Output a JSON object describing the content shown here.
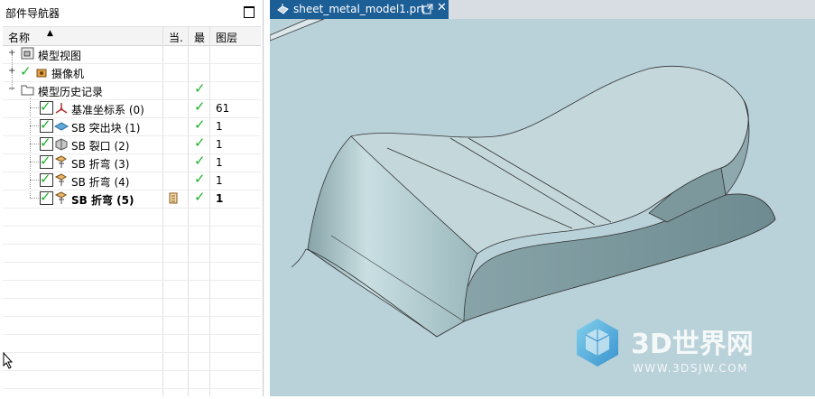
{
  "navigator": {
    "title": "部件导航器",
    "columns": {
      "name": "名称",
      "current": "当.",
      "latest": "最",
      "layer": "图层"
    },
    "rows": [
      {
        "label": "模型视图",
        "layer": "",
        "latest": false,
        "checkbox": false,
        "icon": "model-views-icon"
      },
      {
        "label": "摄像机",
        "layer": "",
        "latest": false,
        "checkbox": false,
        "icon": "camera-icon"
      },
      {
        "label": "模型历史记录",
        "layer": "",
        "latest": true,
        "checkbox": false,
        "icon": "folder-icon"
      },
      {
        "label": "基准坐标系 (0)",
        "layer": "61",
        "latest": true,
        "checkbox": true,
        "icon": "datum-csys-icon"
      },
      {
        "label": "SB 突出块 (1)",
        "layer": "1",
        "latest": true,
        "checkbox": true,
        "icon": "tab-feature-icon"
      },
      {
        "label": "SB 裂口 (2)",
        "layer": "1",
        "latest": true,
        "checkbox": true,
        "icon": "rip-feature-icon"
      },
      {
        "label": "SB 折弯 (3)",
        "layer": "1",
        "latest": true,
        "checkbox": true,
        "icon": "bend-feature-icon"
      },
      {
        "label": "SB 折弯 (4)",
        "layer": "1",
        "latest": true,
        "checkbox": true,
        "icon": "bend-feature-icon"
      },
      {
        "label": "SB 折弯 (5)",
        "layer": "1",
        "latest": true,
        "checkbox": true,
        "icon": "bend-feature-icon",
        "current": true
      }
    ]
  },
  "viewport": {
    "tab_title": "sheet_metal_model1.prt",
    "background_color": "#b9d1d9",
    "accent_color": "#1c5e96"
  },
  "watermark": {
    "brand": "3D世界网",
    "url": "WWW.3DSJW.COM"
  }
}
